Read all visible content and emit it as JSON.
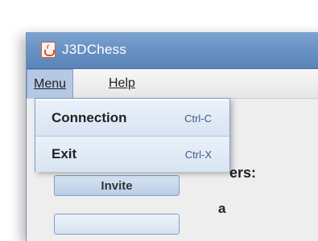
{
  "window": {
    "title": "J3DChess"
  },
  "menubar": {
    "menu_label": "Menu",
    "help_label": "Help"
  },
  "content": {
    "players_label_partial": "ers:",
    "partial_name": "a",
    "invite_label_partial": "Invite"
  },
  "dropdown": {
    "items": [
      {
        "label": "Connection",
        "accelerator": "Ctrl-C"
      },
      {
        "label": "Exit",
        "accelerator": "Ctrl-X"
      }
    ]
  },
  "colors": {
    "titlebar": "#6a92c4",
    "menu_highlight": "#b6c9e4",
    "dropdown_border": "#7f9ec6"
  }
}
